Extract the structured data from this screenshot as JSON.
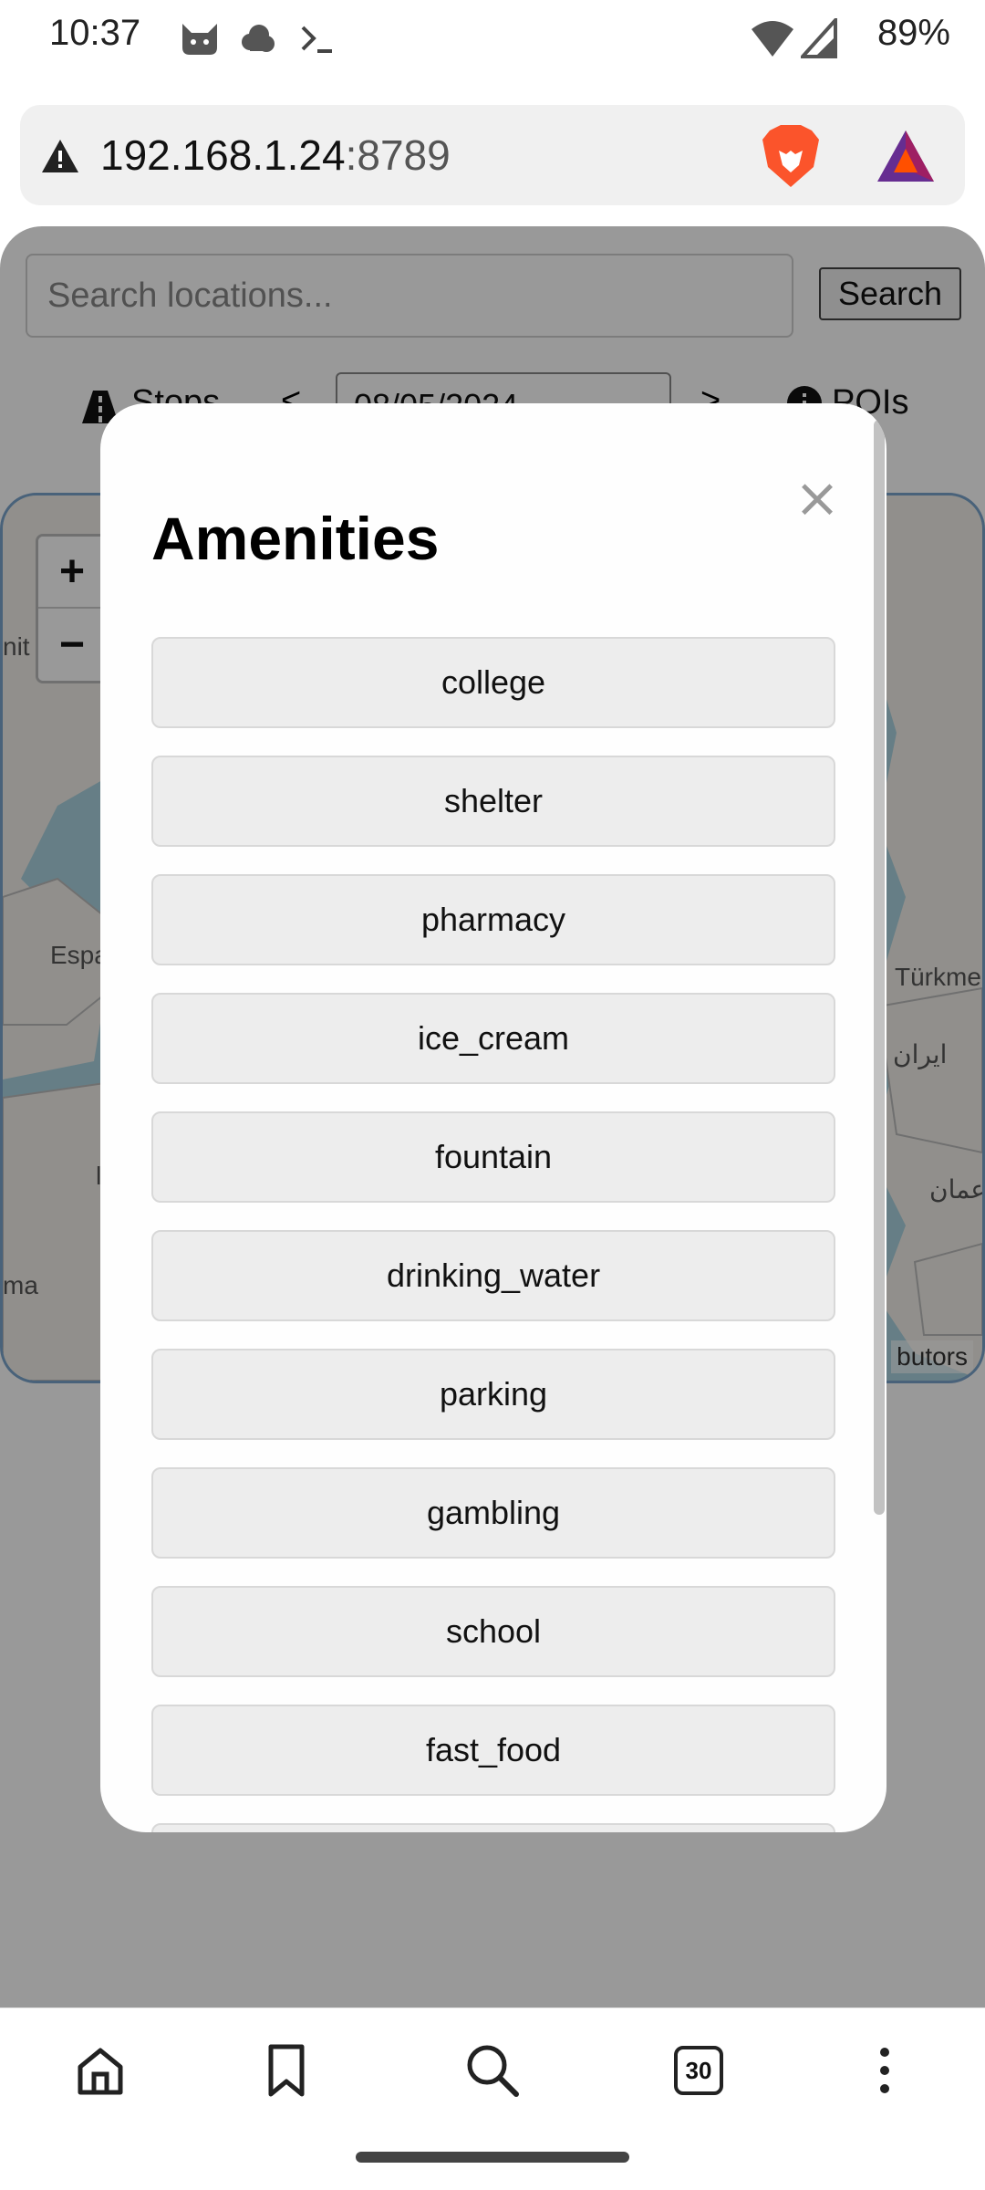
{
  "status_bar": {
    "time": "10:37",
    "battery": "89%",
    "icons": [
      "cat-icon",
      "cloud-icon",
      "terminal-icon",
      "wifi-icon",
      "signal-icon"
    ]
  },
  "browser": {
    "url_host": "192.168.1.24",
    "url_port": ":8789",
    "tabs_count": "30"
  },
  "page": {
    "search_placeholder": "Search locations...",
    "search_label": "Search",
    "stops_label": "Stops",
    "prev_label": "<",
    "next_label": ">",
    "date_value": "08/05/2024",
    "pois_label": "POIs"
  },
  "map": {
    "zoom_in": "+",
    "zoom_out": "−",
    "labels": [
      "nit",
      "Espa",
      "Türkme",
      "ایران",
      "عمان",
      "ma",
      "l"
    ],
    "attribution": "butors"
  },
  "modal": {
    "title": "Amenities",
    "close": "×",
    "items": [
      "college",
      "shelter",
      "pharmacy",
      "ice_cream",
      "fountain",
      "drinking_water",
      "parking",
      "gambling",
      "school",
      "fast_food"
    ]
  },
  "colors": {
    "overlay": "#000000",
    "map_water": "#aad3df",
    "map_land": "#f2efe9",
    "brave_orange": "#fb542b",
    "bat_purple": "#662d91"
  }
}
